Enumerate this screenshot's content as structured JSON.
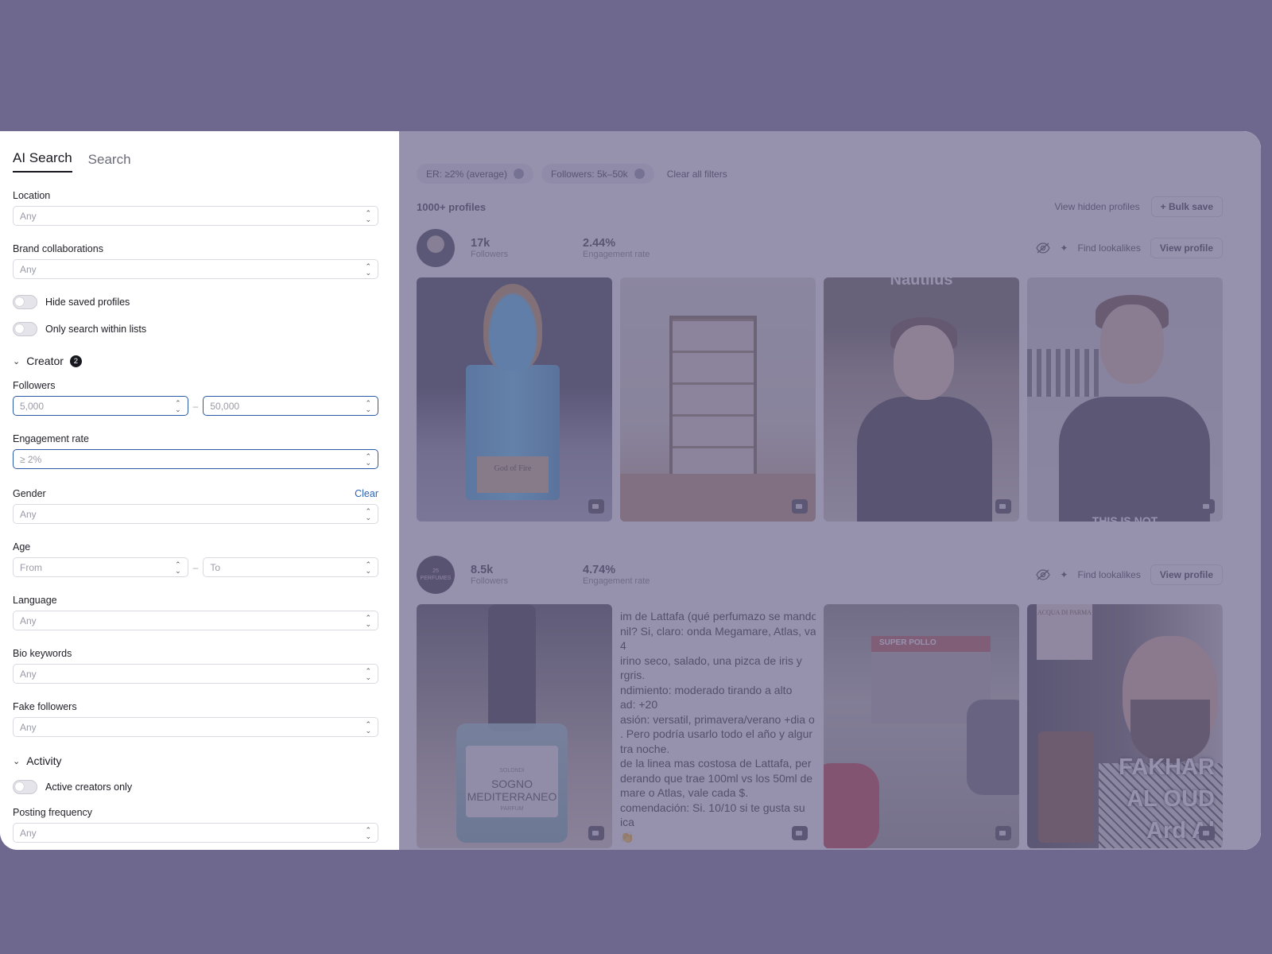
{
  "tabs": [
    "AI Search",
    "Search"
  ],
  "filters": {
    "location": {
      "label": "Location",
      "value": "Any"
    },
    "brand": {
      "label": "Brand collaborations",
      "value": "Any"
    },
    "hide_saved": "Hide saved profiles",
    "only_lists": "Only search within lists",
    "creator_section": {
      "label": "Creator",
      "badge": "2"
    },
    "followers": {
      "label": "Followers",
      "from": "5,000",
      "to": "50,000",
      "dash": "–"
    },
    "engagement": {
      "label": "Engagement rate",
      "value": "≥ 2%"
    },
    "gender": {
      "label": "Gender",
      "value": "Any",
      "clear": "Clear"
    },
    "age": {
      "label": "Age",
      "from": "From",
      "to": "To",
      "dash": "–"
    },
    "language": {
      "label": "Language",
      "value": "Any"
    },
    "bio": {
      "label": "Bio keywords",
      "value": "Any"
    },
    "fake": {
      "label": "Fake followers",
      "value": "Any"
    },
    "activity_section": {
      "label": "Activity"
    },
    "active_only": "Active creators only",
    "posting": {
      "label": "Posting frequency",
      "value": "Any"
    }
  },
  "chips": [
    "ER: ≥2% (average)",
    "Followers: 5k–50k"
  ],
  "clear_all": "Clear all filters",
  "results": {
    "count": "1000+ profiles",
    "view_hidden": "View hidden profiles",
    "bulk_save": "+ Bulk save"
  },
  "profiles": [
    {
      "followers": "17k",
      "followers_label": "Followers",
      "er": "2.44%",
      "er_label": "Engagement rate",
      "lookalikes": "Find lookalikes",
      "view": "View profile",
      "thumb1_label": "God of Fire",
      "thumb3_caption": "Nautilus",
      "thumb4_caption": "THIS IS NOT"
    },
    {
      "avatar_text": "25 PERFUMES",
      "followers": "8.5k",
      "followers_label": "Followers",
      "er": "4.74%",
      "er_label": "Engagement rate",
      "lookalikes": "Find lookalikes",
      "view": "View profile",
      "bottle_brand": "SOLONDI",
      "bottle_name": "SOGNO MEDITERRANEO",
      "bottle_sub": "PARFUM",
      "text_lines": [
        "im de Lattafa (qué perfumazo se mando",
        "nil? Si, claro: onda Megamare, Atlas, va",
        "4 ",
        "irino seco, salado, una pizca de iris y",
        "rgris.",
        "ndimiento: moderado tirando a alto",
        "ad: +20",
        "asión: versatil, primavera/verano +dia o",
        ". Pero podría usarlo todo el año y algur",
        "tra noche.",
        " de la linea mas costosa de Lattafa, per",
        "derando que trae 100ml vs los 50ml de",
        "mare o Atlas, vale cada $.",
        "comendación: Si. 10/10 si te gusta su",
        "ica",
        "👏"
      ],
      "shop_sign": "SUPER POLLO",
      "fakhar_lines": [
        "FAKHAR",
        "AL OUD",
        "Ard Al"
      ],
      "acqua_label": "ACQUA DI PARMA"
    }
  ],
  "colors": {
    "accent": "#2a63b8",
    "backdrop": "#6e688f",
    "overlay": "rgba(110,104,143,0.72)"
  }
}
